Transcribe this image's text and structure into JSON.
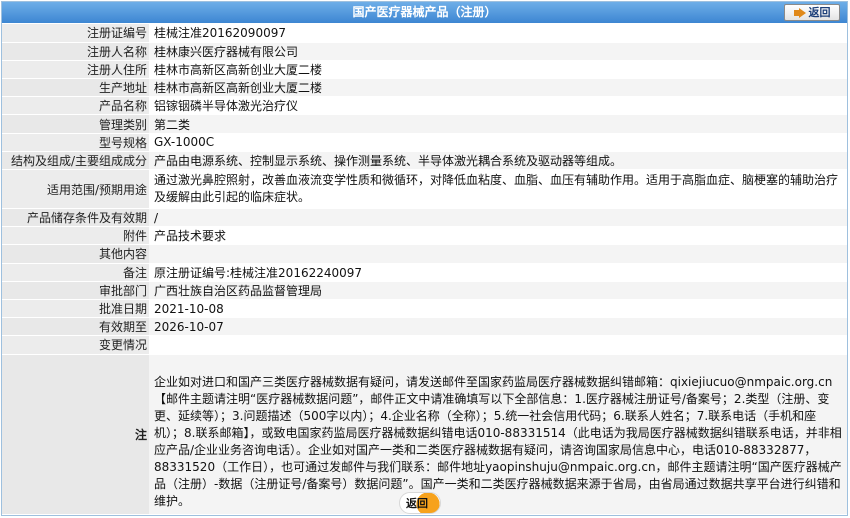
{
  "header": {
    "title": "国产医疗器械产品（注册）",
    "back_label": "返回"
  },
  "rows": [
    {
      "label": "注册证编号",
      "value": "桂械注准20162090097"
    },
    {
      "label": "注册人名称",
      "value": "桂林康兴医疗器械有限公司"
    },
    {
      "label": "注册人住所",
      "value": "桂林市高新区高新创业大厦二楼"
    },
    {
      "label": "生产地址",
      "value": "桂林市高新区高新创业大厦二楼"
    },
    {
      "label": "产品名称",
      "value": "铝镓铟磷半导体激光治疗仪"
    },
    {
      "label": "管理类别",
      "value": "第二类"
    },
    {
      "label": "型号规格",
      "value": "GX-1000C"
    },
    {
      "label": "结构及组成/主要组成成分",
      "value": "产品由电源系统、控制显示系统、操作测量系统、半导体激光耦合系统及驱动器等组成。"
    },
    {
      "label": "适用范围/预期用途",
      "value": "通过激光鼻腔照射，改善血液流变学性质和微循环，对降低血粘度、血脂、血压有辅助作用。适用于高脂血症、脑梗塞的辅助治疗及缓解由此引起的临床症状。"
    },
    {
      "label": "产品储存条件及有效期",
      "value": "/"
    },
    {
      "label": "附件",
      "value": "产品技术要求"
    },
    {
      "label": "其他内容",
      "value": ""
    },
    {
      "label": "备注",
      "value": "原注册证编号:桂械注准20162240097"
    },
    {
      "label": "审批部门",
      "value": "广西壮族自治区药品监督管理局"
    },
    {
      "label": "批准日期",
      "value": "2021-10-08"
    },
    {
      "label": "有效期至",
      "value": "2026-10-07"
    },
    {
      "label": "变更情况",
      "value": ""
    }
  ],
  "note": {
    "label": "注",
    "text": "企业如对进口和国产三类医疗器械数据有疑问，请发送邮件至国家药监局医疗器械数据纠错邮箱：qixiejiucuo@nmpaic.org.cn【邮件主题请注明“医疗器械数据问题”，邮件正文中请准确填写以下全部信息：1.医疗器械注册证号/备案号；2.类型（注册、变更、延续等）；3.问题描述（500字以内）；4.企业名称（全称）；5.统一社会信用代码；6.联系人姓名；7.联系电话（手机和座机）；8.联系邮箱】，或致电国家药监局医疗器械数据纠错电话010-88331514（此电话为我局医疗器械数据纠错联系电话，并非相应产品/企业业务咨询电话）。企业如对国产一类和二类医疗器械数据有疑问，请咨询国家局信息中心，电话010-88332877，88331520（工作日），也可通过发邮件与我们联系：邮件地址yaopinshuju@nmpaic.org.cn，邮件主题请注明“国产医疗器械产品（注册）-数据（注册证号/备案号）数据问题”。国产一类和二类医疗器械数据来源于省局，由省局通过数据共享平台进行纠错和维护。"
  },
  "footer": {
    "back_label": "返回"
  },
  "colors": {
    "header_bg": "#3d86d2",
    "label_bg": "#ececec",
    "accent_orange": "#f7a21c"
  }
}
